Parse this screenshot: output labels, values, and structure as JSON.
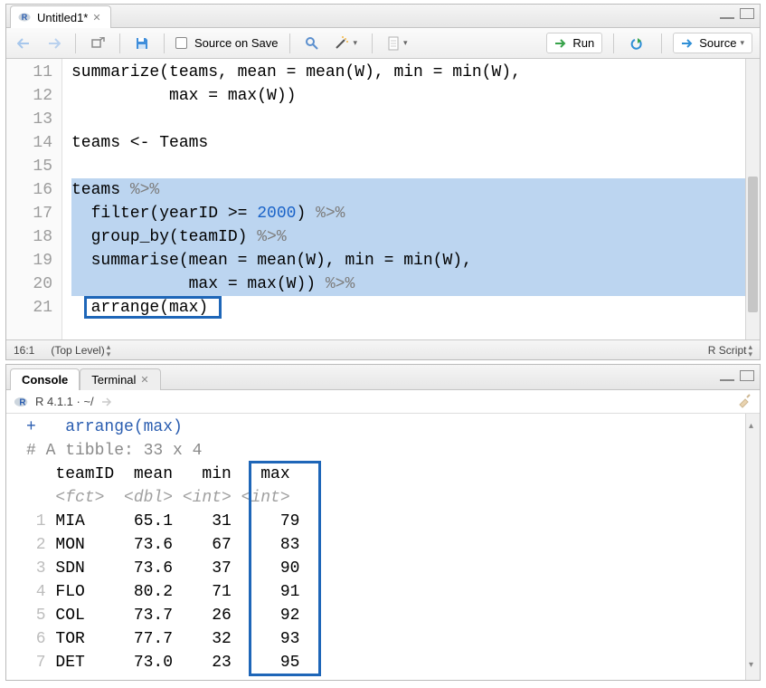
{
  "editor": {
    "tab_title": "Untitled1*",
    "toolbar": {
      "source_on_save": "Source on Save",
      "run": "Run",
      "source": "Source"
    },
    "lines": [
      {
        "n": 11,
        "text": "summarize(teams, mean = mean(W), min = min(W),",
        "sel": false
      },
      {
        "n": 12,
        "text": "          max = max(W))",
        "sel": false
      },
      {
        "n": 13,
        "text": "",
        "sel": false
      },
      {
        "n": 14,
        "text": "teams <- Teams",
        "sel": false
      },
      {
        "n": 15,
        "text": "",
        "sel": false
      },
      {
        "n": 16,
        "text": "teams %>%",
        "sel": true
      },
      {
        "n": 17,
        "text": "  filter(yearID >= 2000) %>%",
        "sel": true,
        "num": "2000"
      },
      {
        "n": 18,
        "text": "  group_by(teamID) %>%",
        "sel": true
      },
      {
        "n": 19,
        "text": "  summarise(mean = mean(W), min = min(W),",
        "sel": true
      },
      {
        "n": 20,
        "text": "            max = max(W)) %>%",
        "sel": true
      },
      {
        "n": 21,
        "text": "  arrange(max)",
        "sel": false,
        "box": true
      }
    ],
    "cursor": "16:1",
    "scope": "(Top Level)",
    "lang": "R Script"
  },
  "console": {
    "tabs": {
      "console": "Console",
      "terminal": "Terminal"
    },
    "info": "R 4.1.1 · ~/",
    "echo": "+   arrange(max)",
    "tibble_header": "# A tibble: 33 x 4",
    "colheads": "   teamID  mean   min   max",
    "coltypes": "   <fct>  <dbl> <int> <int>",
    "rows": [
      {
        "i": "1",
        "team": "MIA",
        "mean": "65.1",
        "min": "31",
        "max": "79"
      },
      {
        "i": "2",
        "team": "MON",
        "mean": "73.6",
        "min": "67",
        "max": "83"
      },
      {
        "i": "3",
        "team": "SDN",
        "mean": "73.6",
        "min": "37",
        "max": "90"
      },
      {
        "i": "4",
        "team": "FLO",
        "mean": "80.2",
        "min": "71",
        "max": "91"
      },
      {
        "i": "5",
        "team": "COL",
        "mean": "73.7",
        "min": "26",
        "max": "92"
      },
      {
        "i": "6",
        "team": "TOR",
        "mean": "77.7",
        "min": "32",
        "max": "93"
      },
      {
        "i": "7",
        "team": "DET",
        "mean": "73.0",
        "min": "23",
        "max": "95"
      }
    ]
  },
  "chart_data": {
    "type": "table",
    "title": "A tibble: 33 x 4",
    "columns": [
      "teamID",
      "mean",
      "min",
      "max"
    ],
    "coltypes": [
      "fct",
      "dbl",
      "int",
      "int"
    ],
    "rows": [
      [
        "MIA",
        65.1,
        31,
        79
      ],
      [
        "MON",
        73.6,
        67,
        83
      ],
      [
        "SDN",
        73.6,
        37,
        90
      ],
      [
        "FLO",
        80.2,
        71,
        91
      ],
      [
        "COL",
        73.7,
        26,
        92
      ],
      [
        "TOR",
        77.7,
        32,
        93
      ],
      [
        "DET",
        73.0,
        23,
        95
      ]
    ],
    "highlighted_column": "max",
    "note": "7 of 33 rows visible; sorted ascending by max via arrange(max)"
  }
}
